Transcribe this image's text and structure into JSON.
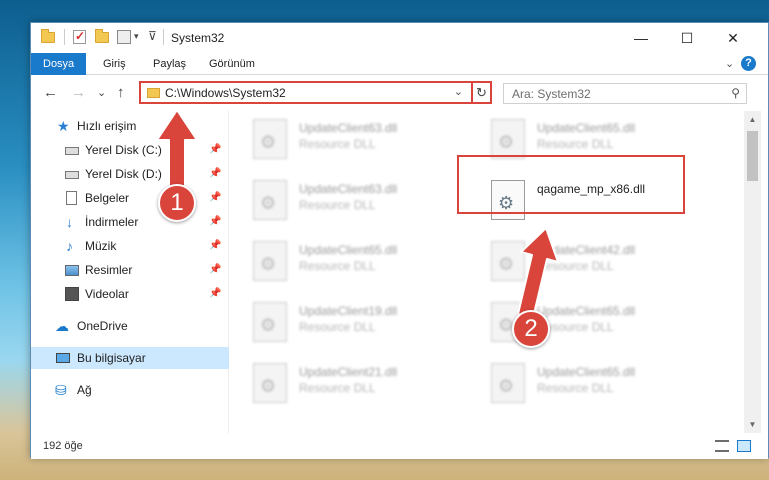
{
  "window": {
    "title": "System32",
    "minimize_glyph": "—",
    "maximize_glyph": "☐",
    "close_glyph": "✕"
  },
  "ribbon": {
    "tabs": [
      {
        "label": "Dosya",
        "active": true
      },
      {
        "label": "Giriş",
        "active": false
      },
      {
        "label": "Paylaş",
        "active": false
      },
      {
        "label": "Görünüm",
        "active": false
      }
    ],
    "collapse_glyph": "⌄",
    "help_glyph": "?"
  },
  "navbar": {
    "back_glyph": "←",
    "forward_glyph": "→",
    "recent_glyph": "⌄",
    "up_glyph": "↑",
    "address_path": "C:\\Windows\\System32",
    "address_dropdown_glyph": "⌄",
    "refresh_glyph": "↻",
    "search_placeholder": "Ara: System32",
    "search_glyph": "⚲"
  },
  "sidebar": {
    "quick_access": "Hızlı erişim",
    "items": [
      {
        "label": "Yerel Disk (C:)",
        "icon": "disk-icon",
        "pinned": true
      },
      {
        "label": "Yerel Disk (D:)",
        "icon": "disk-icon",
        "pinned": true
      },
      {
        "label": "Belgeler",
        "icon": "documents-icon",
        "pinned": true
      },
      {
        "label": "İndirmeler",
        "icon": "downloads-icon",
        "pinned": true
      },
      {
        "label": "Müzik",
        "icon": "music-icon",
        "pinned": true
      },
      {
        "label": "Resimler",
        "icon": "pictures-icon",
        "pinned": true
      },
      {
        "label": "Videolar",
        "icon": "videos-icon",
        "pinned": true
      }
    ],
    "pin_glyph": "📌",
    "onedrive": "OneDrive",
    "this_pc": "Bu bilgisayar",
    "network": "Ağ"
  },
  "files": {
    "left_column": [
      {
        "name": "UpdateClient63.dll",
        "type": "Resource DLL"
      },
      {
        "name": "UpdateClient63.dll",
        "type": "Resource DLL"
      },
      {
        "name": "UpdateClient65.dll",
        "type": "Resource DLL"
      },
      {
        "name": "UpdateClient19.dll",
        "type": "Resource DLL"
      },
      {
        "name": "UpdateClient21.dll",
        "type": "Resource DLL"
      }
    ],
    "right_column": [
      {
        "name": "UpdateClient65.dll",
        "type": "Resource DLL"
      },
      {
        "name": "qagame_mp_x86.dll",
        "type": ""
      },
      {
        "name": "UpdateClient42.dll",
        "type": "Resource DLL"
      },
      {
        "name": "UpdateClient65.dll",
        "type": "Resource DLL"
      },
      {
        "name": "UpdateClient65.dll",
        "type": "Resource DLL"
      }
    ],
    "gear_glyph": "⚙"
  },
  "statusbar": {
    "item_count": "192 öğe"
  },
  "annotations": {
    "badge_1": "1",
    "badge_2": "2",
    "color": "#d9443b"
  }
}
